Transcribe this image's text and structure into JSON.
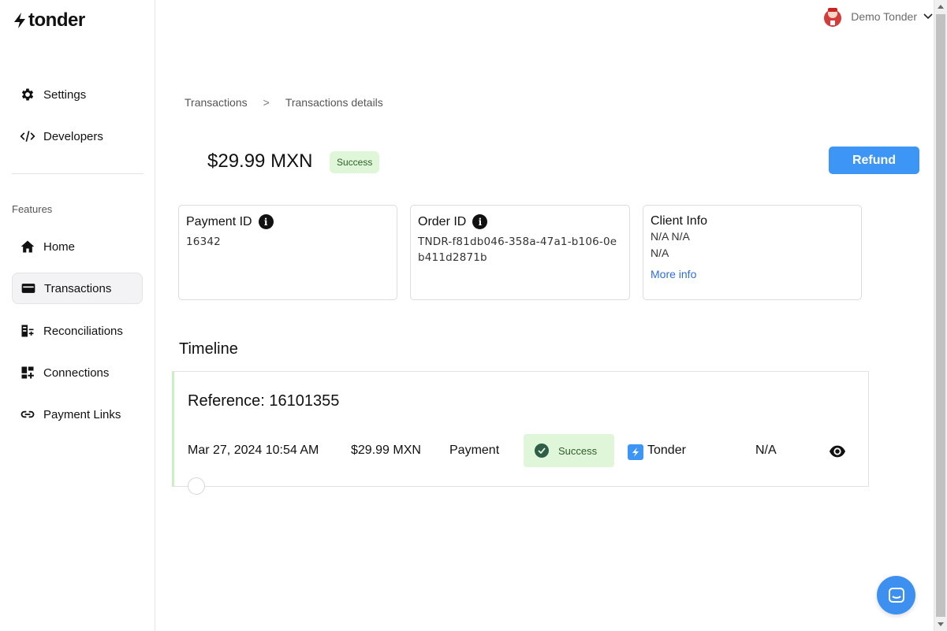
{
  "brand": {
    "name": "tonder",
    "accent": "#3d95f5"
  },
  "user": {
    "name": "Demo Tonder"
  },
  "sidebar": {
    "top_items": [
      {
        "label": "Settings",
        "icon": "gear-icon"
      },
      {
        "label": "Developers",
        "icon": "code-icon"
      }
    ],
    "section_label": "Features",
    "items": [
      {
        "label": "Home",
        "icon": "home-icon"
      },
      {
        "label": "Transactions",
        "icon": "card-icon",
        "active": true
      },
      {
        "label": "Reconciliations",
        "icon": "reconcile-icon"
      },
      {
        "label": "Connections",
        "icon": "dashboard-icon"
      },
      {
        "label": "Payment Links",
        "icon": "link-icon"
      }
    ]
  },
  "breadcrumb": {
    "parent": "Transactions",
    "separator": ">",
    "current": "Transactions details"
  },
  "header": {
    "amount": "$29.99 MXN",
    "status": "Success",
    "refund_label": "Refund"
  },
  "cards": {
    "payment": {
      "title": "Payment ID",
      "value": "16342"
    },
    "order": {
      "title": "Order ID",
      "value": "TNDR-f81db046-358a-47a1-b106-0eb411d2871b"
    },
    "client": {
      "title": "Client Info",
      "name": "N/A N/A",
      "email": "N/A",
      "link": "More info"
    }
  },
  "timeline": {
    "title": "Timeline",
    "reference": "Reference: 16101355",
    "entry": {
      "date": "Mar 27, 2024 10:54 AM",
      "amount": "$29.99 MXN",
      "type": "Payment",
      "status": "Success",
      "provider": "Tonder",
      "extra": "N/A"
    }
  }
}
